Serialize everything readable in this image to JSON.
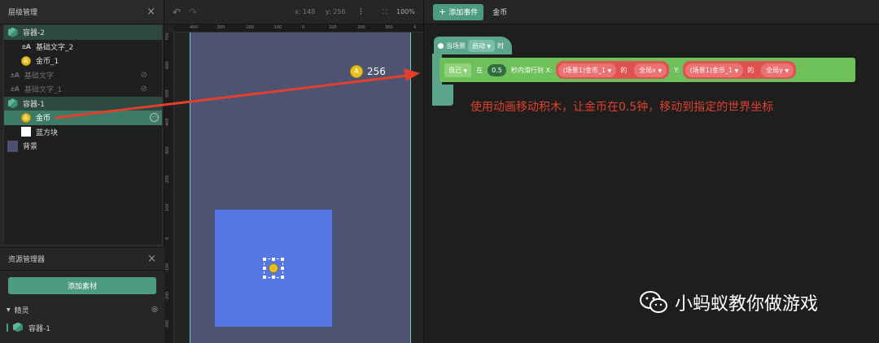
{
  "layers": {
    "title": "层级管理",
    "items": [
      {
        "label": "容器-2",
        "icon": "container-icon"
      },
      {
        "label": "基础文字_2",
        "icon": "text-icon"
      },
      {
        "label": "金币_1",
        "icon": "coin-icon"
      },
      {
        "label": "基础文字",
        "icon": "text-icon",
        "hidden": true
      },
      {
        "label": "基础文字_1",
        "icon": "text-icon",
        "hidden": true
      },
      {
        "label": "容器-1",
        "icon": "container-icon"
      },
      {
        "label": "金币",
        "icon": "coin-icon",
        "selected": true
      },
      {
        "label": "蓝方块",
        "icon": "white-square-icon"
      },
      {
        "label": "背景",
        "icon": "background-icon"
      }
    ]
  },
  "assets": {
    "title": "资源管理器",
    "add_button": "添加素材",
    "section": "精灵",
    "item": "容器-1"
  },
  "canvas": {
    "x_label": "x: 148",
    "y_label": "y: 256",
    "zoom": "100%",
    "ruler_top": [
      "-400",
      "-300",
      "-200",
      "-100",
      "0",
      "100",
      "200",
      "300",
      "4"
    ],
    "ruler_left": [
      "700",
      "600",
      "500",
      "400",
      "300",
      "200",
      "100",
      "0",
      "-100",
      "-200",
      "-300"
    ],
    "coin_score": "256"
  },
  "script": {
    "add_event_button": "添加事件",
    "tab_name": "金币",
    "hat": {
      "prefix": "当场景",
      "event": "启动",
      "suffix": "时"
    },
    "cmd": {
      "target": "自己",
      "in": "在",
      "seconds": "0.5",
      "glide_text": "秒内滑行到 X:",
      "x_obj": "(场景1)金币_1",
      "of": "的",
      "x_prop": "全局x",
      "y_label": "Y:",
      "y_obj": "(场景1)金币_1",
      "y_prop": "全局y"
    }
  },
  "annotation": "使用动画移动积木，让金币在0.5钟，移动到指定的世界坐标",
  "watermark": "小蚂蚁教你做游戏",
  "colors": {
    "accent": "#4d9c80",
    "arrow": "#e2402c",
    "stage": "#4d5370",
    "blue_square": "#5577e6"
  }
}
